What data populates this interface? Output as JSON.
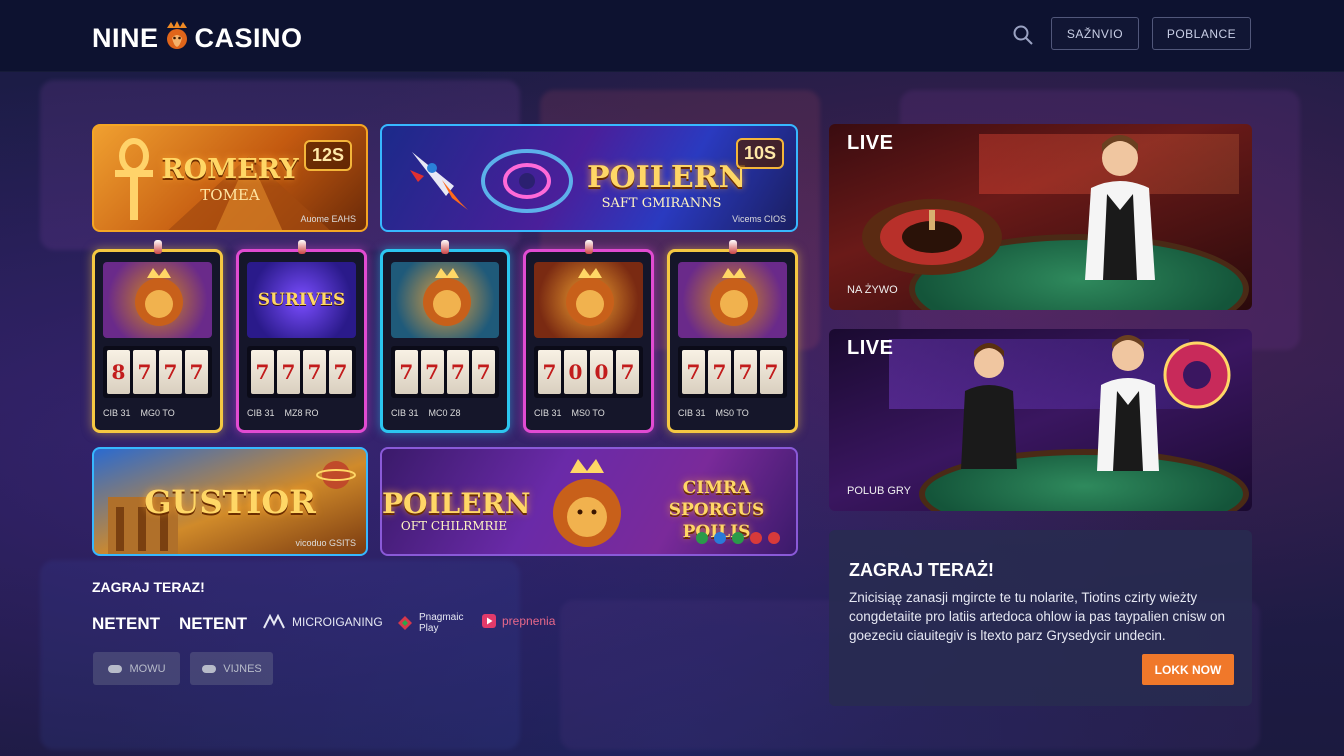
{
  "brand": {
    "name_left": "NINE",
    "name_right": "CASINO"
  },
  "header": {
    "button_1": "SAŽNVIO",
    "button_2": "POBLANCE"
  },
  "featured": [
    {
      "title": "ROMERY",
      "subtitle": "TOMEA",
      "badge": "12S",
      "footer": "Auome EAHS"
    },
    {
      "title": "POILERN",
      "subtitle": "SAFT GMIRANNS",
      "badge": "10S",
      "footer": "Vicems CIOS"
    },
    {
      "title": "GUSTIOR",
      "subtitle": "",
      "badge": "",
      "footer": "vicoduo GSITS"
    },
    {
      "title": "POILERN",
      "subtitle": "OFT CHILRMRIE",
      "badge": "",
      "footer": ""
    }
  ],
  "promo_text": "CIMRA SPORGUS POILIS",
  "slots": [
    {
      "name": "",
      "reels": [
        "8",
        "7",
        "7",
        "7"
      ],
      "left_info": "CIB 31",
      "mid_info": "MG0 TO"
    },
    {
      "name": "SURIVES",
      "reels": [
        "7",
        "7",
        "7",
        "7"
      ],
      "left_info": "CIB 31",
      "mid_info": "MZ8 RO"
    },
    {
      "name": "",
      "reels": [
        "7",
        "7",
        "7",
        "7"
      ],
      "left_info": "CIB 31",
      "mid_info": "MC0 Z8"
    },
    {
      "name": "",
      "reels": [
        "7",
        "0",
        "0",
        "7"
      ],
      "left_info": "CIB 31",
      "mid_info": "MS0 TO"
    },
    {
      "name": "",
      "reels": [
        "7",
        "7",
        "7",
        "7"
      ],
      "left_info": "CIB 31",
      "mid_info": "MS0 TO"
    }
  ],
  "live": [
    {
      "tag": "LIVE",
      "caption": "NA ŻYWO"
    },
    {
      "tag": "LIVE",
      "caption": "POLUB GRY"
    }
  ],
  "cta": {
    "title": "ZAGRAJ TERAŻ!",
    "body": "Znicisiąę zanasji mgircte te tu nolarite, Tiotins czirty wieżty congdetaiite pro latiis artedoca ohlow ia pas taypalien cnisw on goezeciu ciauitegiv is ltexto parz Grysedycir undecin.",
    "button": "LOKK NOW"
  },
  "providers": {
    "heading": "ZAGRAJ TERAZ!",
    "items": [
      "NETENT",
      "NETENT",
      "MICROIGANING",
      "Pnagmaic Play",
      "prepnenia"
    ]
  },
  "bottom_buttons": [
    "MOWU",
    "VIJNES"
  ],
  "colors": {
    "accent": "#f0782a",
    "header_bg": "#0d1230",
    "live_cta_bg": "#2a2d52"
  }
}
